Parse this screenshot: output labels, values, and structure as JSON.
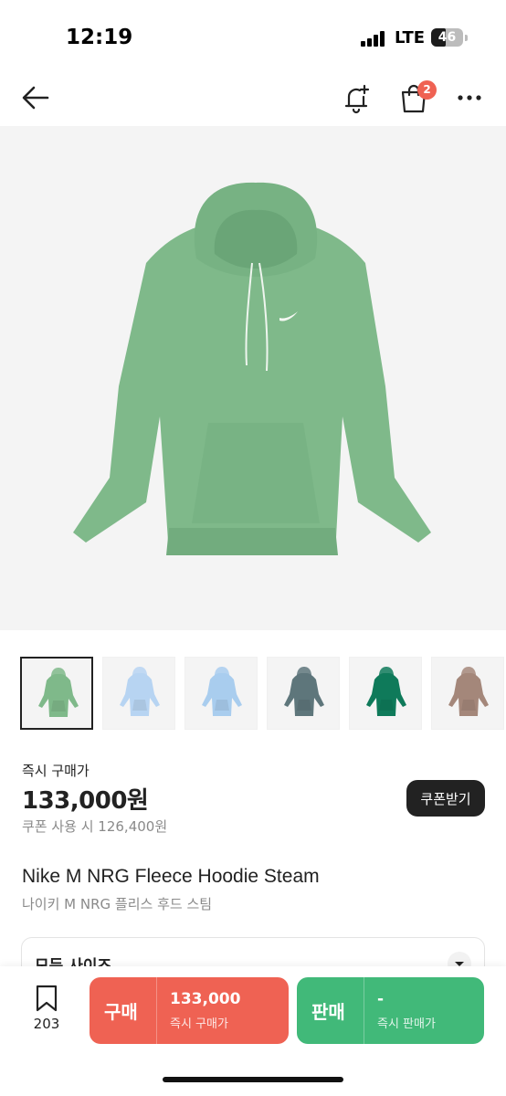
{
  "status_bar": {
    "time": "12:19",
    "network": "LTE",
    "battery": "46",
    "battery_level": 0.46
  },
  "nav": {
    "back_icon": "arrow-left-icon",
    "alert_icon": "bell-plus-icon",
    "cart_icon": "shopping-bag-icon",
    "cart_count": "2",
    "more_icon": "more-horizontal-icon"
  },
  "product": {
    "image_color": "#7fb98a",
    "thumbnails": [
      {
        "color": "#7fb98a",
        "selected": true
      },
      {
        "color": "#b7d4f2",
        "selected": false
      },
      {
        "color": "#a9cdee",
        "selected": false
      },
      {
        "color": "#5e767b",
        "selected": false
      },
      {
        "color": "#0f7a5a",
        "selected": false
      },
      {
        "color": "#a4877a",
        "selected": false
      }
    ],
    "price_label": "즉시 구매가",
    "price": "133,000원",
    "coupon_price": "쿠폰 사용 시 126,400원",
    "coupon_button": "쿠폰받기",
    "name": "Nike M NRG Fleece Hoodie Steam",
    "name_ko": "나이키 M NRG 플리스 후드 스팀",
    "size_label": "모든 사이즈"
  },
  "bottom_bar": {
    "wish_icon": "bookmark-icon",
    "wish_count": "203",
    "buy": {
      "label": "구매",
      "value": "133,000",
      "sub": "즉시 구매가"
    },
    "sell": {
      "label": "판매",
      "value": "-",
      "sub": "즉시 판매가"
    },
    "buy_color": "#ef6253",
    "sell_color": "#41b979"
  }
}
